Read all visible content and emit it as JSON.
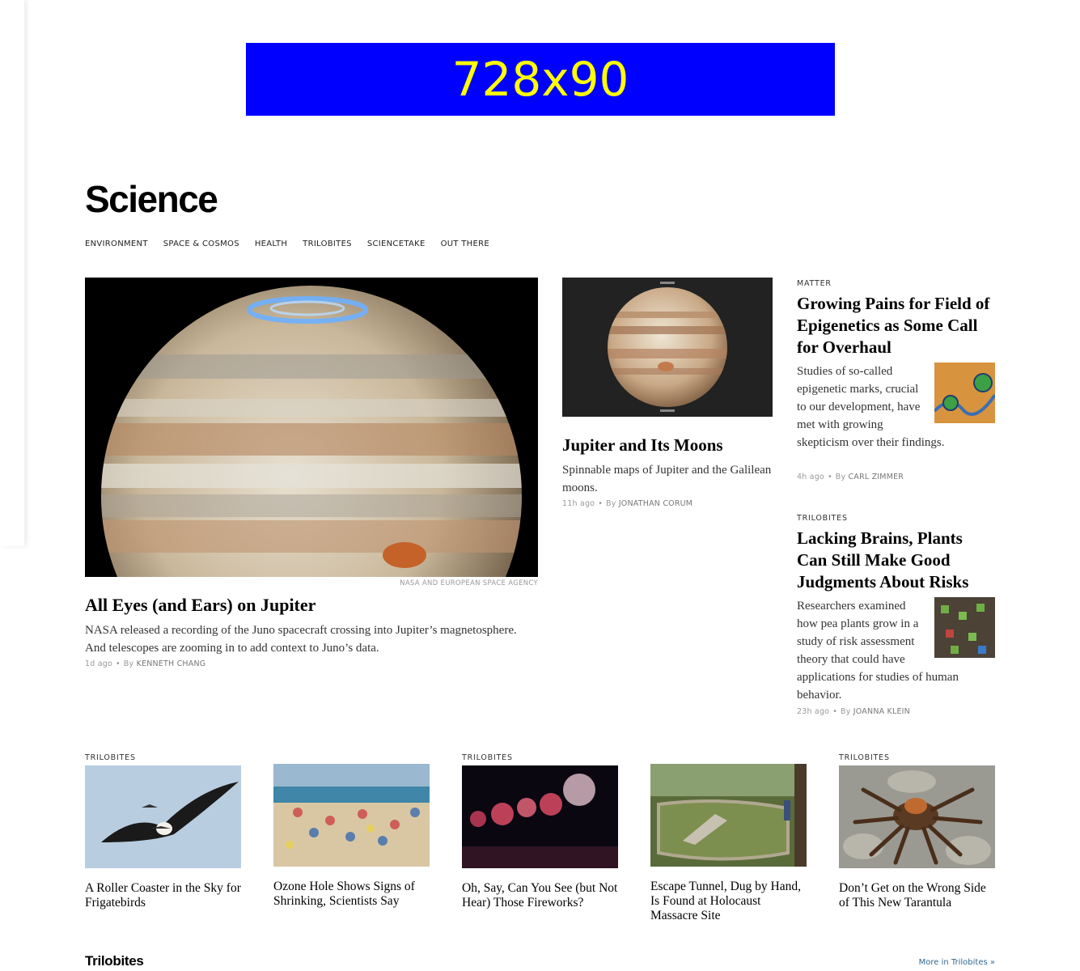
{
  "ad": {
    "label": "728x90"
  },
  "section": {
    "title": "Science"
  },
  "subnav": [
    "ENVIRONMENT",
    "SPACE & COSMOS",
    "HEALTH",
    "TRILOBITES",
    "SCIENCETAKE",
    "OUT THERE"
  ],
  "lead": {
    "credit": "NASA AND EUROPEAN SPACE AGENCY",
    "headline": "All Eyes (and Ears) on Jupiter",
    "summary": "NASA released a recording of the Juno spacecraft crossing into Jupiter’s magnetosphere. And telescopes are zooming in to add context to Juno’s data.",
    "time": "1d ago",
    "by": "By",
    "author": "KENNETH CHANG"
  },
  "second": {
    "headline": "Jupiter and Its Moons",
    "summary": "Spinnable maps of Jupiter and the Galilean moons.",
    "time": "11h ago",
    "by": "By",
    "author": "JONATHAN CORUM"
  },
  "right1": {
    "kicker": "MATTER",
    "headline": "Growing Pains for Field of Epigenetics as Some Call for Overhaul",
    "summary": "Studies of so-called epigenetic marks, crucial to our development, have met with growing skepticism over their findings.",
    "time": "4h ago",
    "by": "By",
    "author": "CARL ZIMMER"
  },
  "right2": {
    "kicker": "TRILOBITES",
    "headline": "Lacking Brains, Plants Can Still Make Good Judgments About Risks",
    "summary": "Researchers examined how pea plants grow in a study of risk assessment theory that could have applications for studies of human behavior.",
    "time": "23h ago",
    "by": "By",
    "author": "JOANNA KLEIN"
  },
  "cards": [
    {
      "kicker": "TRILOBITES",
      "title": "A Roller Coaster in the Sky for Frigatebirds"
    },
    {
      "kicker": "",
      "title": "Ozone Hole Shows Signs of Shrinking, Scientists Say"
    },
    {
      "kicker": "TRILOBITES",
      "title": "Oh, Say, Can You See (but Not Hear) Those Fireworks?"
    },
    {
      "kicker": "",
      "title": "Escape Tunnel, Dug by Hand, Is Found at Holocaust Massacre Site"
    },
    {
      "kicker": "TRILOBITES",
      "title": "Don’t Get on the Wrong Side of This New Tarantula"
    }
  ],
  "footer": {
    "title": "Trilobites",
    "more": "More in Trilobites »"
  },
  "colors": {
    "ad_bg": "#0000ff",
    "ad_text": "#ffff00",
    "link": "#326891"
  }
}
